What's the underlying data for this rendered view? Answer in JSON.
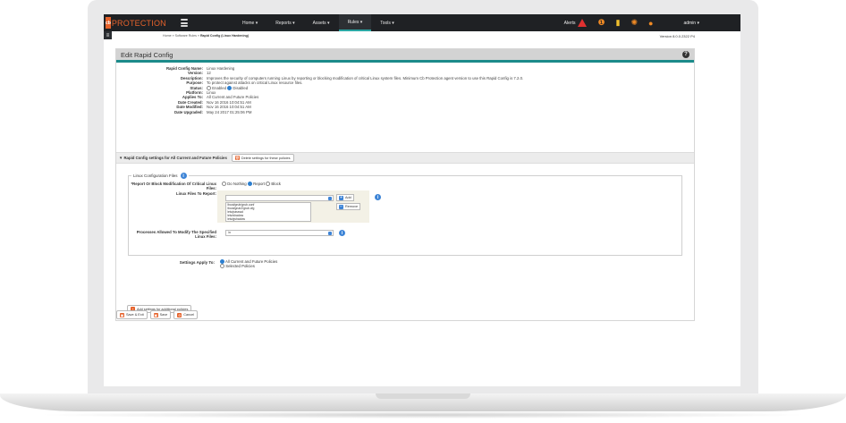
{
  "nav": {
    "brand_badge": "cb",
    "brand": "PROTECTION",
    "menu": [
      "Home ▾",
      "Reports ▾",
      "Assets ▾",
      "Rules ▾",
      "Tools ▾"
    ],
    "alerts_label": "Alerts",
    "alert_count": "1",
    "user": "admin ▾",
    "accent": "#2aa7a4",
    "brand_color": "#e5622b"
  },
  "breadcrumb": {
    "path": "Home » Software Rules » ",
    "current": "Rapid Config (Linux Hardening)"
  },
  "version": "Version 8.0.0.2322 P4",
  "panel": {
    "title": "Edit Rapid Config"
  },
  "details": [
    {
      "label": "Rapid Config Name:",
      "value": "Linux Hardening"
    },
    {
      "label": "Version:",
      "value": "12"
    },
    {
      "label": "Description:",
      "value": "Improves the security of computers running Linux by reporting or blocking modification of critical Linux system files. Minimum Cb Protection agent version to use this Rapid Config is 7.2.0."
    },
    {
      "label": "Purpose:",
      "value": "To protect against attacks on critical Linux resource files."
    },
    {
      "label": "Status:",
      "value": ""
    },
    {
      "label": "Platform:",
      "value": "Linux"
    },
    {
      "label": "Applies To:",
      "value": "All Current and Future Policies"
    },
    {
      "label": "Date Created:",
      "value": "Nov 16 2016 10:04:51 AM"
    },
    {
      "label": "Date Modified:",
      "value": "Nov 16 2016 10:04:51 AM"
    },
    {
      "label": "Date Upgraded:",
      "value": "May 24 2017 01:25:06 PM"
    }
  ],
  "status_options": {
    "enabled": "Enabled",
    "disabled": "Disabled"
  },
  "section": {
    "title": "▼ Rapid Config settings for All Current and Future Policies",
    "delete_btn": "Delete settings for these policies"
  },
  "fieldset": {
    "legend": "Linux Configuration Files",
    "report_label": "*Report Or Block Modification Of Critical Linux Files:",
    "report_options": [
      "Do Nothing",
      "Report",
      "Block"
    ],
    "files_label": "Linux Files To Report:",
    "add_btn": "Add",
    "remove_btn": "Remove",
    "files": [
      "/boot/grub/grub.conf",
      "/boot/grub2/grub.cfg",
      "/etc/passwd",
      "/etc/shadow",
      "/etc/gshadow"
    ],
    "processes_label": "Processes Allowed To Modify The Specified Linux Files:",
    "processes_value": "\\n"
  },
  "apply": {
    "label": "Settings Apply To:",
    "opt_all": "All Current and Future Policies",
    "opt_selected": "Selected Policies"
  },
  "add_settings_btn": "Add settings for additional policies",
  "footer": {
    "save_exit": "Save & Exit",
    "save": "Save",
    "cancel": "Cancel"
  }
}
